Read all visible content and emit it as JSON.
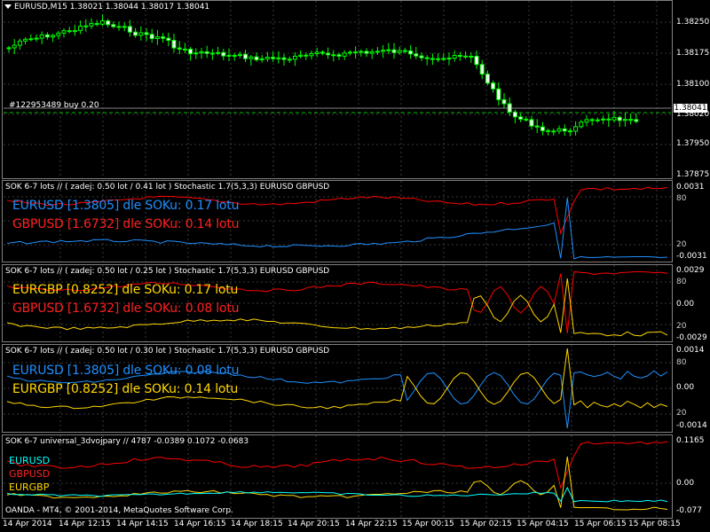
{
  "main": {
    "title": "EURUSD,M15  1.38021 1.38044 1.38017 1.38041",
    "order_label": "#122953489 buy 0.20",
    "axis": [
      "1.38250",
      "1.38175",
      "1.38100",
      "1.38025",
      "1.37950",
      "1.37875"
    ],
    "current_price": "1.38041",
    "lower_price_label": "1.38020"
  },
  "panes": [
    {
      "header": "SOK 6-7 lots  //  ( zadej: 0.50 lot / 0.41 lot )  Stochastic 1.7(5,3,3) EURUSD GBPUSD",
      "line1": "EURUSD [1.3805]  dle SOKu: 0.17 lotu",
      "line2": "GBPUSD [1.6732]  dle SOKu: 0.14 lotu",
      "axis_right": [
        "0.0031",
        "80",
        "20",
        "-0.0031"
      ]
    },
    {
      "header": "SOK 6-7 lots  //  ( zadej: 0.50 lot / 0.25 lot )  Stochastic 1.7(5,3,3) EURUSD GBPUSD",
      "line1": "EURGBP [0.8252]  dle SOKu: 0.17 lotu",
      "line2": "GBPUSD [1.6732]  dle SOKu: 0.08 lotu",
      "axis_right": [
        "0.0029",
        "80",
        "0.00",
        "20",
        "-0.0029"
      ]
    },
    {
      "header": "SOK 6-7 lots  //  ( zadej: 0.50 lot / 0.30 lot )  Stochastic 1.7(5,3,3) EURUSD GBPUSD",
      "line1": "EURUSD [1.3805]  dle SOKu: 0.08 lotu",
      "line2": "EURGBP [0.8252]  dle SOKu: 0.14 lotu",
      "axis_right": [
        "0.0014",
        "80",
        "0.00",
        "20",
        "-0.0014"
      ]
    }
  ],
  "universal": {
    "header": "SOK 6-7 universal_3dvojpary  //  4787 -0.0389 0.1072 -0.0683",
    "legend": [
      "EURUSD",
      "GBPUSD",
      "EURGBP"
    ],
    "axis_right": [
      "0.1165",
      "0.00",
      "-0.077"
    ],
    "copyright": "OANDA - MT4, © 2001-2014, MetaQuotes Software Corp."
  },
  "time_axis": [
    "14 Apr 2014",
    "14 Apr 12:15",
    "14 Apr 14:15",
    "14 Apr 16:15",
    "14 Apr 18:15",
    "14 Apr 20:15",
    "14 Apr 22:15",
    "15 Apr 00:15",
    "15 Apr 02:15",
    "15 Apr 04:15",
    "15 Apr 06:15",
    "15 Apr 08:15"
  ],
  "colors": {
    "bull_candle": "#000000",
    "bull_outline": "#00ff00",
    "bear_candle": "#ffffff",
    "grid": "#3a3a3a",
    "eurusd": "#1e90ff",
    "gbpusd": "#ff0000",
    "eurgbp": "#ffd700",
    "eurusd_universal": "#00ffff"
  }
}
